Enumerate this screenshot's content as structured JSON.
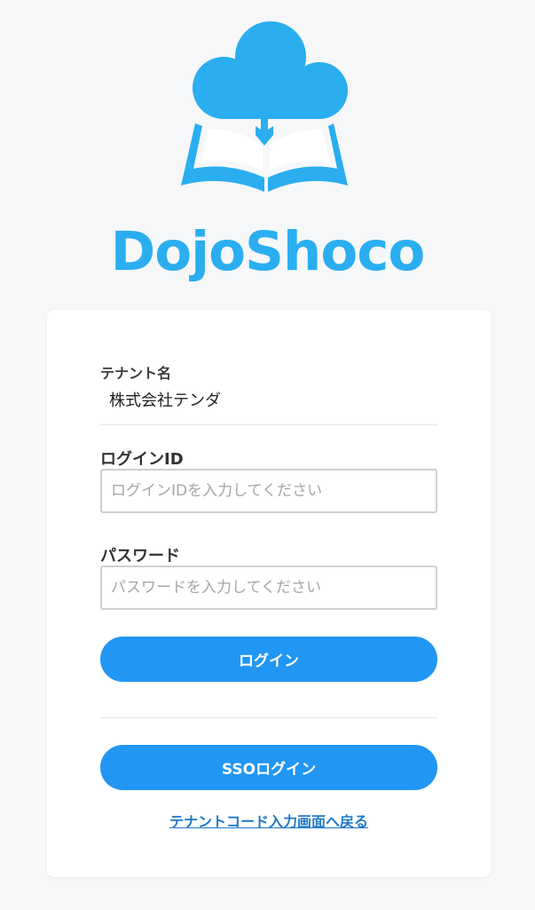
{
  "brand": {
    "name": "DojoShoco",
    "color": "#2aaef0",
    "logo_icon": "cloud-book-icon"
  },
  "form": {
    "tenant": {
      "label": "テナント名",
      "value": "株式会社テンダ"
    },
    "login_id": {
      "label": "ログインID",
      "value": "",
      "placeholder": "ログインIDを入力してください"
    },
    "password": {
      "label": "パスワード",
      "value": "",
      "placeholder": "パスワードを入力してください"
    },
    "login_button": "ログイン",
    "sso_button": "SSOログイン",
    "back_link": "テナントコード入力画面へ戻る"
  },
  "colors": {
    "accent": "#2196f3",
    "link": "#1f78c7",
    "background": "#f6f7f9"
  }
}
